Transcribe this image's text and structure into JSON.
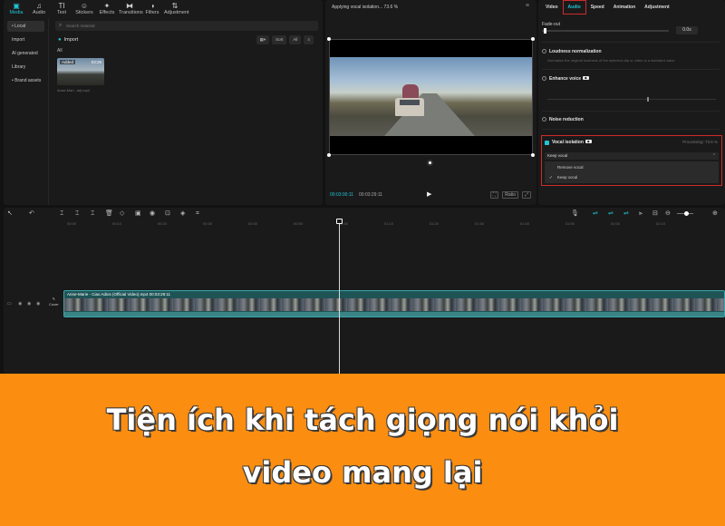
{
  "media_panel": {
    "tabs": [
      {
        "icon": "media-icon",
        "glyph": "▣",
        "label": "Media"
      },
      {
        "icon": "audio-icon",
        "glyph": "♫",
        "label": "Audio"
      },
      {
        "icon": "text-icon",
        "glyph": "TI",
        "label": "Text"
      },
      {
        "icon": "stickers-icon",
        "glyph": "☺",
        "label": "Stickers"
      },
      {
        "icon": "effects-icon",
        "glyph": "✦",
        "label": "Effects"
      },
      {
        "icon": "transitions-icon",
        "glyph": "⧓",
        "label": "Transitions"
      },
      {
        "icon": "filters-icon",
        "glyph": "◑",
        "label": "Filters"
      },
      {
        "icon": "adjustment-icon",
        "glyph": "⇅",
        "label": "Adjustment"
      }
    ],
    "sidebar": [
      "• Local",
      "Import",
      "AI generated",
      "Library",
      "• Brand assets"
    ],
    "search_placeholder": "Search material",
    "import_label": "Import",
    "sort_label": "Sort",
    "all_filter": "All",
    "all_label": "All",
    "clip": {
      "badge": "Added",
      "duration": "03:29",
      "name": "Anne-Mari...ial).mp4"
    }
  },
  "player": {
    "title": "Applying vocal isolation... 73.6 %",
    "time_current": "00:03:00:11",
    "time_total": "00:03:29:11",
    "ratio_label": "Ratio"
  },
  "inspector": {
    "tabs": [
      "Video",
      "Audio",
      "Speed",
      "Animation",
      "Adjustment"
    ],
    "fadeout_label": "Fade-out",
    "fadeout_value": "0.0s",
    "loudness_title": "Loudness normalization",
    "loudness_desc": "Normalize the original loudness of the selected clip or video to a standard value",
    "enhance_title": "Enhance voice",
    "noise_title": "Noise reduction",
    "vocal": {
      "title": "Vocal isolation",
      "progress": "Processing: 73.6 %",
      "selected": "Keep vocal",
      "options": [
        "Remove vocal",
        "Keep vocal"
      ]
    }
  },
  "timeline": {
    "ticks": [
      "00:00",
      "00:10",
      "00:20",
      "00:30",
      "00:40",
      "00:50",
      "01:00",
      "01:10",
      "01:20",
      "01:30",
      "01:40",
      "01:50",
      "02:00",
      "02:10"
    ],
    "clip_label": "Anne-Marie - Ciao Adios (Official Video).mp4  00:03:29:11",
    "cover_label": "Cover"
  },
  "banner": {
    "line1": "Tiện ích khi tách giọng nói khỏi",
    "line2": "video mang lại"
  }
}
